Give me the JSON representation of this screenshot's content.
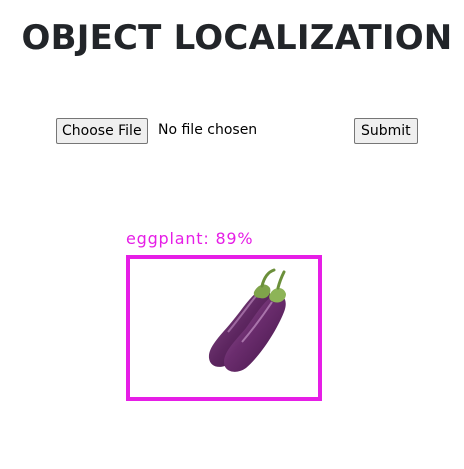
{
  "header": {
    "title": "OBJECT LOCALIZATION"
  },
  "upload": {
    "choose_file_label": "Choose File",
    "file_status": "No file chosen",
    "submit_label": "Submit"
  },
  "result": {
    "detection_label": "eggplant: 89%",
    "box_color": "#e61ee6",
    "object_icon": "eggplant-image"
  }
}
